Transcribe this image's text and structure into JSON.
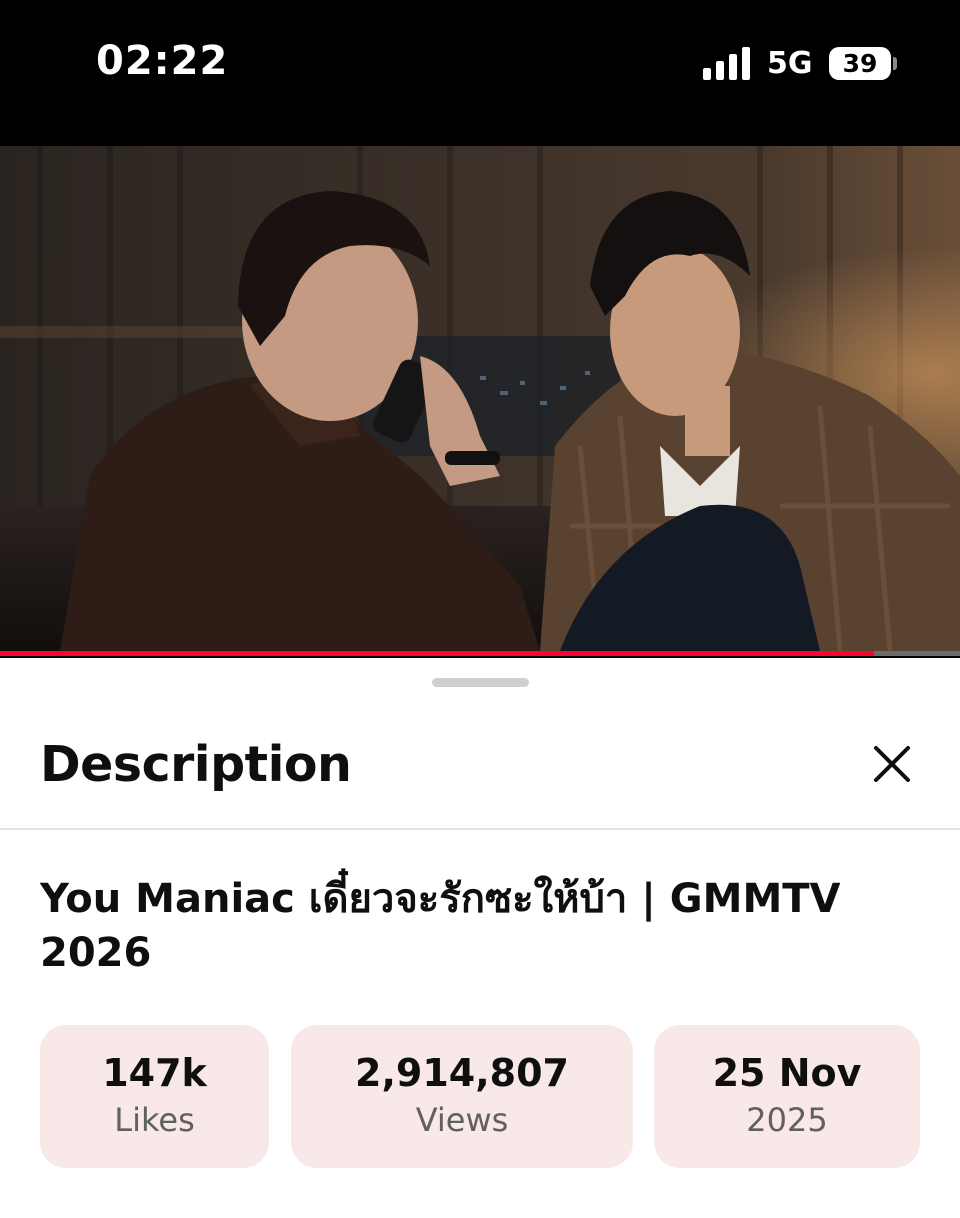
{
  "status_bar": {
    "time": "02:22",
    "network": "5G",
    "battery": "39"
  },
  "video": {
    "progress_fraction": 0.91
  },
  "description_sheet": {
    "title": "Description",
    "video_title": "You Maniac เดี๋ยวจะรักซะให้บ้า | GMMTV 2026",
    "stats": {
      "likes": {
        "value": "147k",
        "label": "Likes"
      },
      "views": {
        "value": "2,914,807",
        "label": "Views"
      },
      "date": {
        "value": "25 Nov",
        "label": "2025"
      }
    }
  },
  "colors": {
    "progress_accent": "#ff0033",
    "stat_chip_background": "#f8e8e8"
  }
}
